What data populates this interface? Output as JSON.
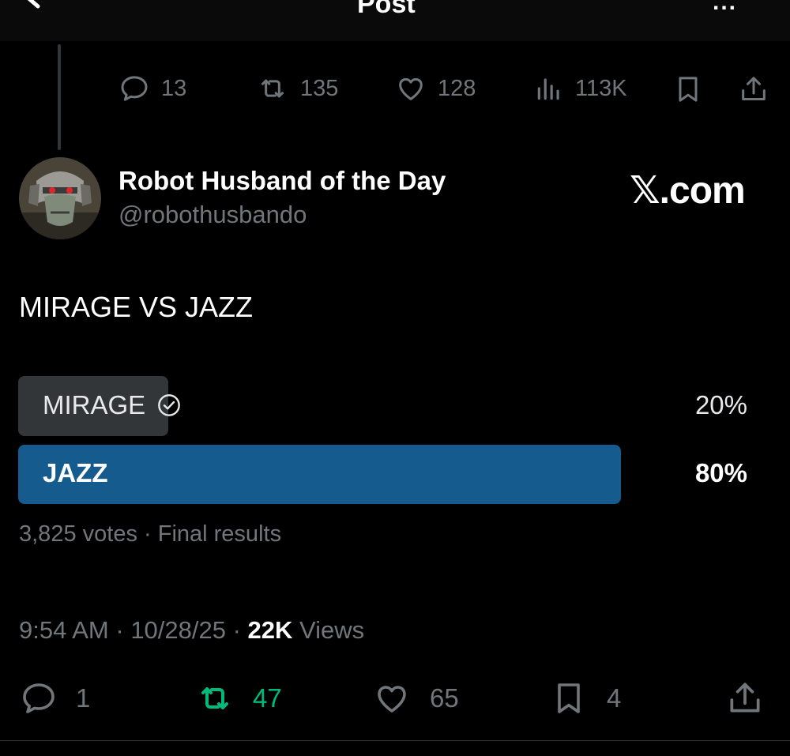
{
  "header": {
    "title": "Post",
    "more_label": "..."
  },
  "parent_actions": {
    "replies": "13",
    "reposts": "135",
    "likes": "128",
    "views": "113K"
  },
  "author": {
    "name": "Robot Husband of the Day",
    "handle": "@robothusbando",
    "brand": "𝕏.com"
  },
  "post": {
    "text": "MIRAGE VS JAZZ",
    "poll": {
      "options": [
        {
          "label": "MIRAGE",
          "percent": "20%",
          "value": 20,
          "voted": true
        },
        {
          "label": "JAZZ",
          "percent": "80%",
          "value": 80,
          "winner": true
        }
      ],
      "votes": "3,825 votes",
      "separator": " · ",
      "status": "Final results"
    },
    "time": "9:54 AM",
    "date": "10/28/25",
    "view_count": "22K",
    "views_label": "Views"
  },
  "post_actions": {
    "replies": "1",
    "reposts": "47",
    "likes": "65",
    "bookmarks": "4"
  },
  "colors": {
    "background": "#000000",
    "muted": "#71767b",
    "poll_winner": "#155b8d",
    "poll_other": "#333639",
    "repost_active": "#00ba7c"
  }
}
